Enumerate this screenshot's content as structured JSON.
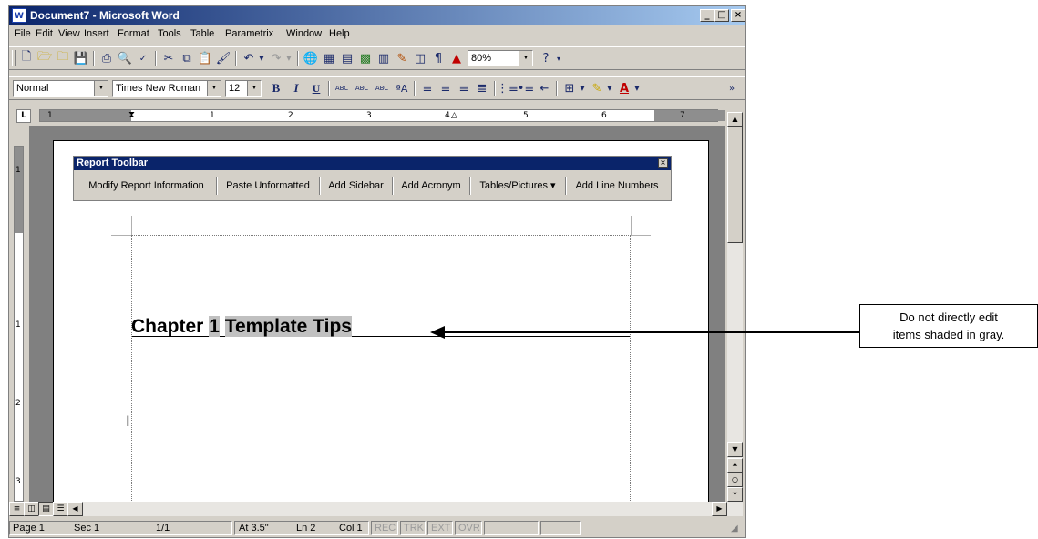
{
  "window": {
    "title": "Document7 - Microsoft Word",
    "app_icon": "W"
  },
  "menu": [
    "File",
    "Edit",
    "View",
    "Insert",
    "Format",
    "Tools",
    "Table",
    "Parametrix",
    "Window",
    "Help"
  ],
  "standard_toolbar": {
    "zoom": "80%"
  },
  "format_toolbar": {
    "style": "Normal",
    "font": "Times New Roman",
    "size": "12"
  },
  "ruler": {
    "numbers": [
      "1",
      "2",
      "3",
      "4",
      "5",
      "6",
      "7"
    ],
    "vertical_numbers": [
      "1",
      "2",
      "3"
    ]
  },
  "report_toolbar": {
    "title": "Report Toolbar",
    "buttons": [
      "Modify Report Information",
      "Paste Unformatted",
      "Add Sidebar",
      "Add Acronym",
      "Tables/Pictures ▾",
      "Add Line Numbers"
    ]
  },
  "document": {
    "heading_prefix": "Chapter ",
    "heading_number": "1",
    "heading_title": "Template Tips"
  },
  "callout": {
    "line1": "Do not directly edit",
    "line2": "items shaded in gray."
  },
  "status": {
    "page": "Page 1",
    "sec": "Sec 1",
    "pages": "1/1",
    "at": "At 3.5\"",
    "ln": "Ln 2",
    "col": "Col 1",
    "rec": "REC",
    "trk": "TRK",
    "ext": "EXT",
    "ovr": "OVR"
  },
  "icons": {
    "new": "new-document-icon",
    "open": "open-folder-icon",
    "save": "save-icon",
    "print": "print-icon",
    "spell": "spelling-icon",
    "bold": "bold-icon",
    "italic": "italic-icon",
    "underline": "underline-icon"
  }
}
